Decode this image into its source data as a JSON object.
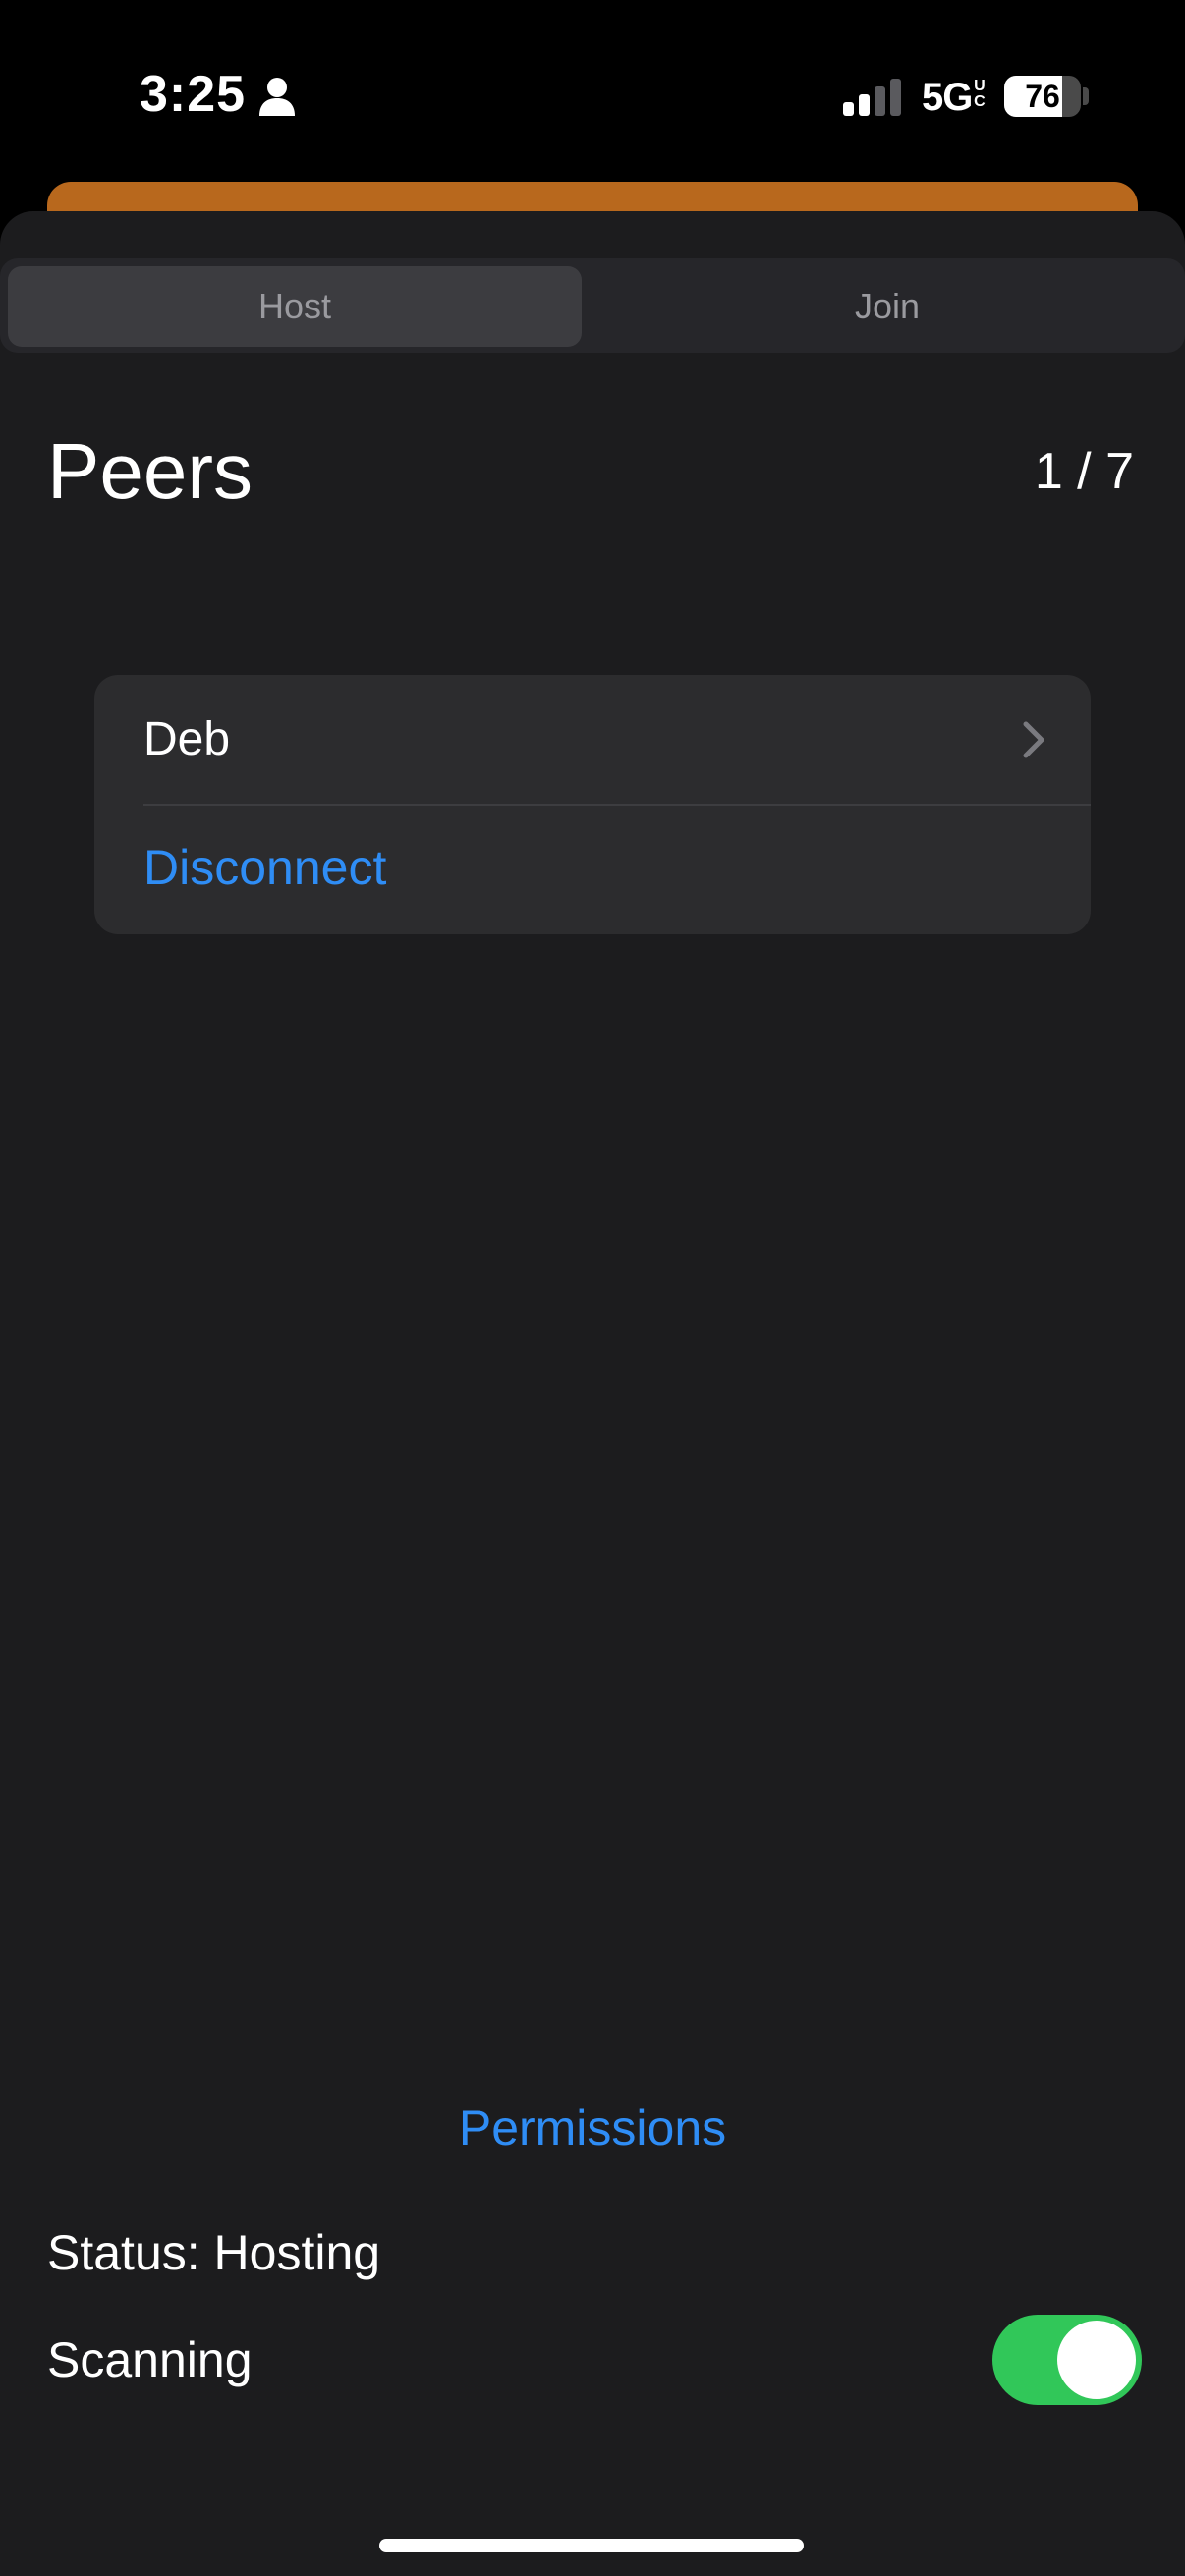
{
  "status_bar": {
    "time": "3:25",
    "network": "5G",
    "network_sup": "UC",
    "battery_percent": "76",
    "battery_level": 0.76,
    "person_icon": "person-icon",
    "signal_icon": "cellular-signal-icon"
  },
  "segmented_control": {
    "tabs": [
      {
        "label": "Host",
        "selected": true
      },
      {
        "label": "Join",
        "selected": false
      }
    ]
  },
  "peers": {
    "title": "Peers",
    "count": "1 / 7",
    "items": [
      {
        "name": "Deb",
        "action": "Disconnect"
      }
    ]
  },
  "footer": {
    "permissions_label": "Permissions",
    "status_text": "Status: Hosting",
    "scanning_label": "Scanning",
    "scanning_on": true
  },
  "colors": {
    "accent_blue": "#2f8df5",
    "toggle_green": "#31c759",
    "background_sheet": "#1c1c1e",
    "card": "#2c2c2e",
    "behind_sheet_orange": "#b8681d"
  }
}
